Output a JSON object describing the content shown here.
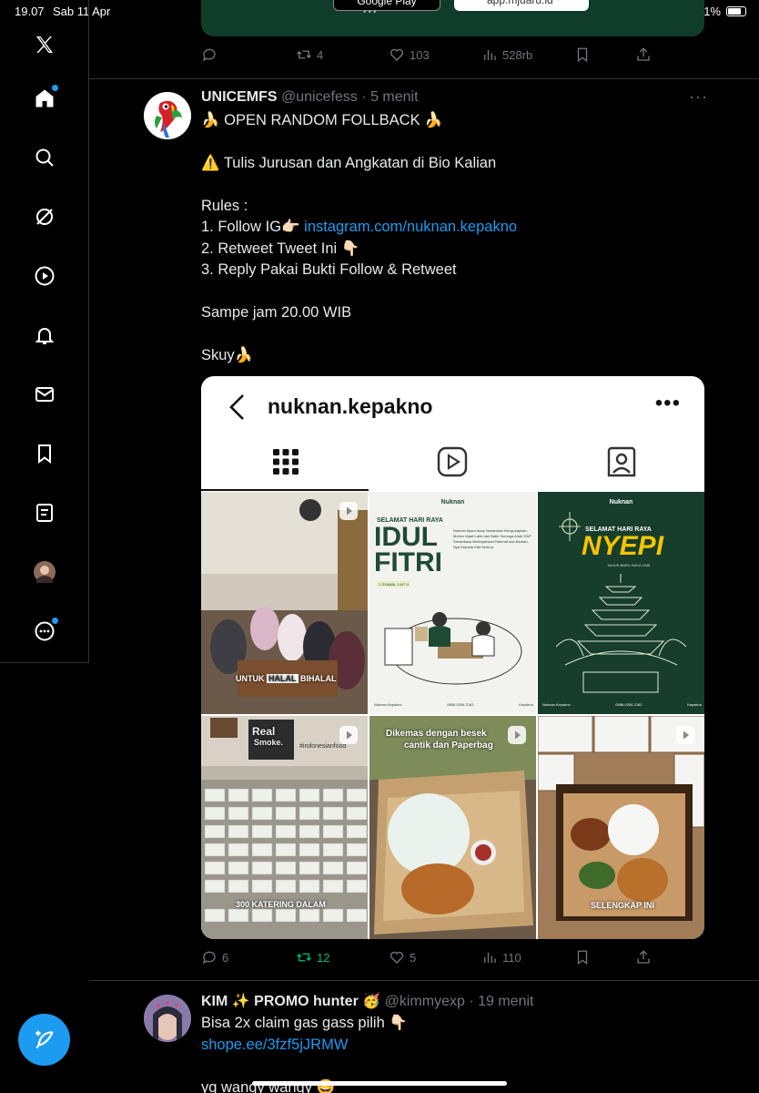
{
  "status": {
    "time": "19.07",
    "date": "Sab 11 Apr",
    "battery": "71%"
  },
  "sidebar": {
    "items": [
      "x-logo",
      "home",
      "explore",
      "grok",
      "video",
      "notifications",
      "messages",
      "bookmarks",
      "lists",
      "profile",
      "more"
    ]
  },
  "top_card": {
    "store1": "Google Play",
    "store2": "app.mjuaru.id"
  },
  "prev_tweet": {
    "retweets": "4",
    "likes": "103",
    "views": "528rb"
  },
  "tweet": {
    "name": "UNICEMFS",
    "handle": "@unicefess",
    "time": "· 5 menit",
    "line1": "🍌 OPEN RANDOM FOLLBACK 🍌",
    "line2": "⚠️ Tulis Jurusan dan Angkatan di Bio Kalian",
    "line3": "Rules :",
    "line4_prefix": "1. Follow IG👉🏻 ",
    "line4_link": "instagram.com/nuknan.kepakno",
    "line5": "2. Retweet Tweet Ini 👇🏻",
    "line6": "3. Reply Pakai Bukti Follow & Retweet",
    "line7": "Sampe jam 20.00 WIB",
    "line8": "Skuy🍌",
    "replies": "6",
    "retweets": "12",
    "likes": "5",
    "views": "110"
  },
  "ig": {
    "username": "nuknan.kepakno",
    "tile1_caption_a": "UNTUK ",
    "tile1_caption_b": "HALAL",
    "tile1_caption_c": " BIHALAL",
    "tile2_brand": "Nuknan",
    "tile2_title_small": "SELAMAT HARI RAYA",
    "tile2_title_1": "IDUL",
    "tile2_title_2": "FITRI",
    "tile2_sub": "1 SYAWAL 1447 H",
    "tile2_body": "Nuknan Ayam Asap Nusantara Mengucapkan, Mohon Maaf Lahir dan Batin Semoga Allah SWT Senantiasa Melimpahkan Rahmat dan Berkah-Nya Kepada Kita Semua",
    "tile2_footer_ig": "Nuknan.Kepakno",
    "tile2_footer_phone": "0856-0254-2162",
    "tile2_footer_tt": "Kepakno",
    "tile3_brand": "Nuknan",
    "tile3_title_small": "SELAMAT HARI RAYA",
    "tile3_title": "NYEPI",
    "tile3_sub": "TAHUN BARU SAKA 1948",
    "tile3_footer_ig": "Nuknan.Kepakno",
    "tile3_footer_phone": "0856-0254-2162",
    "tile3_footer_tt": "Kepakno",
    "tile4_sign_1": "Real",
    "tile4_sign_2": "Smoke.",
    "tile4_tag": "#indonesianfood",
    "tile4_caption": "300 KATERING DALAM",
    "tile5_caption_1": "Dikemas dengan besek",
    "tile5_caption_2": "cantik dan Paperbag",
    "tile6_caption": "SELENGKAP INI"
  },
  "tweet2": {
    "name": "KIM ✨ PROMO hunter 🥳",
    "handle": "@kimmyexp",
    "time": "· 19 menit",
    "line1": "Bisa 2x claim gas gass pilih 👇🏻",
    "link": "shope.ee/3fzf5jJRMW",
    "line3": "yg wangy wangy 🤩"
  },
  "colors": {
    "accent": "#1d9bf0",
    "retweet_green": "#00ba7c",
    "muted": "#71767b"
  }
}
